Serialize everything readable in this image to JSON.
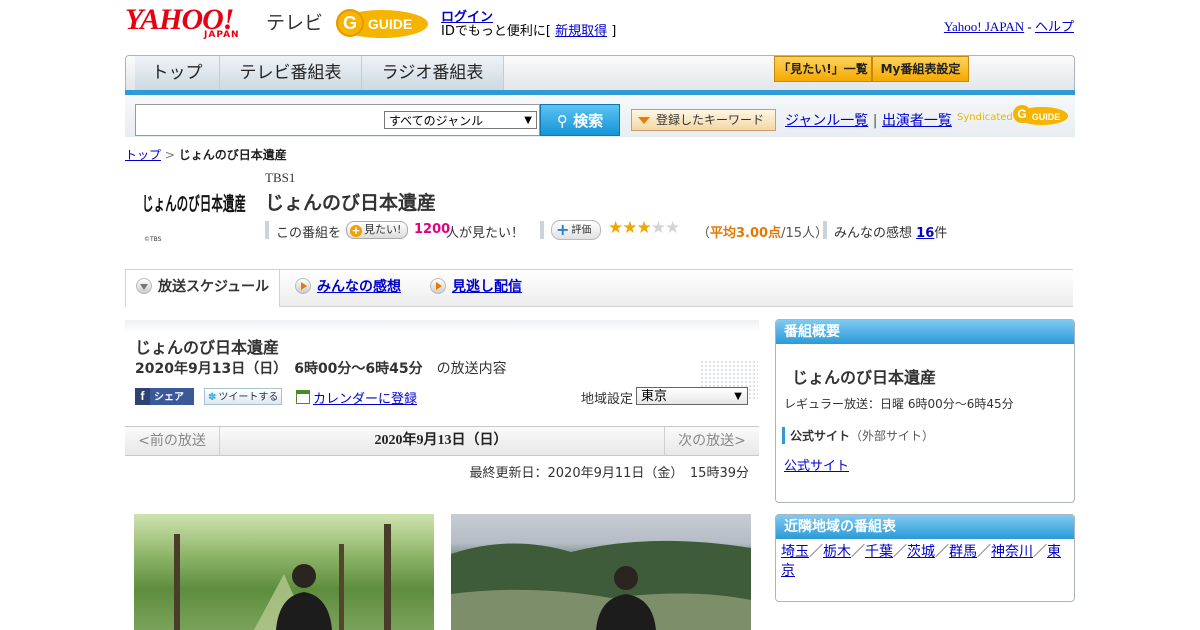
{
  "header": {
    "yahoo_logo": "YAHOO!",
    "yahoo_japan": "JAPAN",
    "tv_label": "テレビ",
    "gguide_logo": "G-GUIDE",
    "login": "ログイン",
    "login_sub_prefix": "IDでもっと便利に[ ",
    "signup": "新規取得",
    "login_sub_suffix": " ]",
    "yahoo_japan_link": "Yahoo! JAPAN",
    "help_sep": " - ",
    "help": "ヘルプ"
  },
  "nav": {
    "tabs": [
      "トップ",
      "テレビ番組表",
      "ラジオ番組表"
    ],
    "mitai_list": "「見たい!」一覧",
    "my_guide": "My番組表設定"
  },
  "search": {
    "placeholder": "",
    "genre": "すべてのジャンル",
    "button": "検索",
    "keyword_button": "登録したキーワード",
    "genre_list": "ジャンル一覧",
    "sep": " | ",
    "performer_list": "出演者一覧",
    "syndicated": "Syndicated"
  },
  "breadcrumb": {
    "top": "トップ",
    "sep": " > ",
    "current": "じょんのび日本遺産"
  },
  "program": {
    "logo_text": "じょんのび日本遺産",
    "logo_copyright": "©TBS",
    "channel": "TBS1",
    "title": "じょんのび日本遺産",
    "mitai_prefix": "この番組を",
    "mitai_button": "見たい!",
    "mitai_count": "1200",
    "mitai_suffix": "人が見たい！",
    "rate_button": "評価",
    "rating": 3,
    "rating_max": 5,
    "rating_open": "（",
    "rating_avg": "平均3.00点",
    "rating_count": "/15人）",
    "reviews_prefix": "みんなの感想",
    "reviews_count": "16",
    "reviews_suffix": "件"
  },
  "tabs": {
    "schedule": "放送スケジュール",
    "reviews": "みんなの感想",
    "catchup": "見逃し配信"
  },
  "episode": {
    "title": "じょんのび日本遺産",
    "date": "2020年9月13日（日）",
    "time": "6時00分～6時45分",
    "suffix": "の放送内容",
    "share_fb": "シェア",
    "tweet": "ツイートする",
    "calendar": "カレンダーに登録",
    "region_label": "地域設定",
    "region": "東京",
    "prev": "<前の放送",
    "next": "次の放送>",
    "nav_date": "2020年9月13日（日）",
    "updated": "最終更新日：2020年9月11日（金）　15時39分"
  },
  "sidebar": {
    "overview_header": "番組概要",
    "overview_title": "じょんのび日本遺産",
    "regular": "レギュラー放送：日曜 6時00分～6時45分",
    "official_label": "公式サイト",
    "official_note": "（外部サイト）",
    "official_link": "公式サイト",
    "nearby_header": "近隣地域の番組表",
    "nearby": [
      "埼玉",
      "栃木",
      "千葉",
      "茨城",
      "群馬",
      "神奈川",
      "東京"
    ],
    "nearby_sep": "／"
  },
  "colors": {
    "yahoo_red": "#e60012",
    "accent_blue": "#2e9ad7",
    "link_blue": "#0000cc",
    "pink_count": "#e4007f",
    "star": "#f0a800"
  }
}
